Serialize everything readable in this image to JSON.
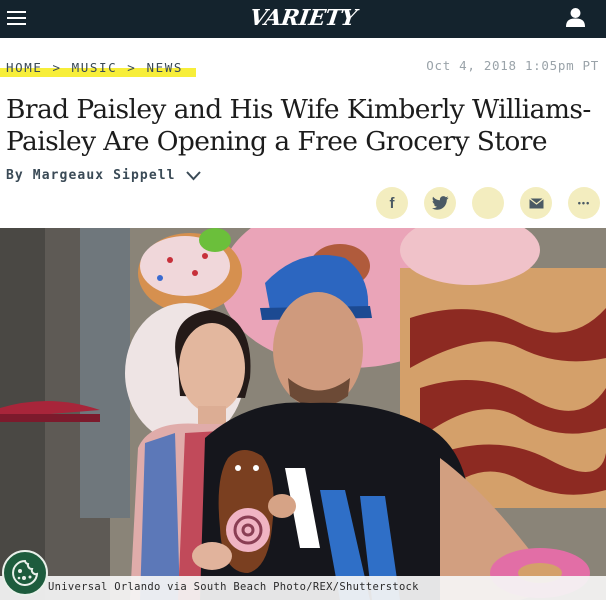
{
  "header": {
    "logo_text": "VARIETY",
    "menu_icon": "hamburger-menu-icon",
    "account_icon": "user-icon",
    "background": "#14232d"
  },
  "breadcrumb": {
    "items": [
      "HOME",
      "MUSIC",
      "NEWS"
    ],
    "separator": ">",
    "highlight_color": "#f7ee3a"
  },
  "article": {
    "date": "Oct 4, 2018 1:05pm PT",
    "headline": "Brad Paisley and His Wife Kimberly Williams-Paisley Are Opening a Free Grocery Store",
    "byline": "By Margeaux Sippell",
    "byline_icon": "chevron-down-icon"
  },
  "share": {
    "buttons": [
      {
        "icon": "facebook-icon",
        "label": "f"
      },
      {
        "icon": "twitter-icon",
        "label": ""
      },
      {
        "icon": "blank-share-icon",
        "label": ""
      },
      {
        "icon": "email-icon",
        "label": ""
      },
      {
        "icon": "more-icon",
        "label": "•••"
      }
    ],
    "button_color": "#f3edbf"
  },
  "photo": {
    "credit": "Universal Orlando via South Beach Photo/REX/Shutterstock",
    "cookie_icon": "cookie-icon"
  }
}
